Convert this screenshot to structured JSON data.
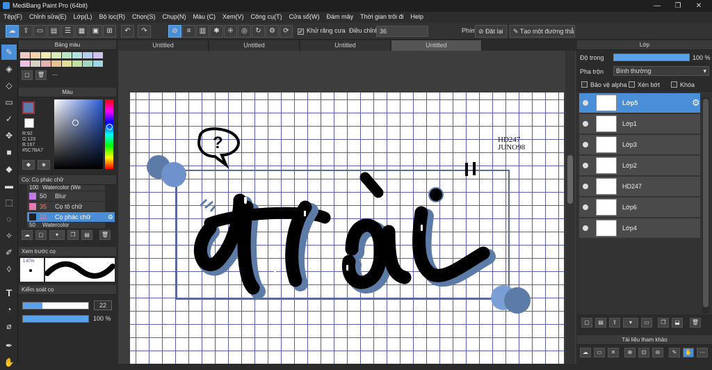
{
  "window": {
    "title": "MediBang Paint Pro (64bit)",
    "minimize": "—",
    "maximize": "❐",
    "close": "✕"
  },
  "menu": [
    "Tệp(F)",
    "Chỉnh sửa(E)",
    "Lớp(L)",
    "Bộ lọc(R)",
    "Chọn(S)",
    "Chụp(N)",
    "Màu (C)",
    "Xem(V)",
    "Công cụ(T)",
    "Cửa sổ(W)",
    "Đám mây",
    "Thời gian trôi đi",
    "Help"
  ],
  "toolbar": {
    "antialias_label": "Khử răng cưa",
    "adjust_label": "Điều chỉnh",
    "adjust_value": "36",
    "stroke_label": "Phím",
    "reset_label": "Đặt lại",
    "create_line_label": "Tạo một đường thẳng"
  },
  "tabs": [
    "Untitled",
    "Untitled",
    "Untitled",
    "Untitled"
  ],
  "palette_panel": {
    "title": "Bảng màu",
    "dash": "---"
  },
  "color_panel": {
    "title": "Màu",
    "r": "R:92",
    "g": "G:123",
    "b": "B:167",
    "hex": "#5C7BA7"
  },
  "brush_panel": {
    "title": "Cọ: Cọ phác chữ",
    "items": [
      {
        "size": "100",
        "name": "Watercolor (We"
      },
      {
        "size": "50",
        "name": "Blur"
      },
      {
        "size": "35",
        "name": "Cọ tô chữ"
      },
      {
        "size": "22",
        "name": "Cọ phác chữ"
      },
      {
        "size": "50",
        "name": "Watercolor"
      }
    ]
  },
  "preview_panel": {
    "title": "Xem trước cọ",
    "size": "1.67m"
  },
  "control_panel": {
    "title": "Kiểm soát cọ",
    "size": "22",
    "opacity": "100 %",
    "size_fraction": 0.3,
    "opacity_fraction": 1.0
  },
  "layer_panel": {
    "title": "Lớp",
    "opacity_label": "Độ trong",
    "opacity_value": "100 %",
    "blend_label": "Pha trộn",
    "blend_value": "Bình thường",
    "protect_alpha": "Bảo vệ alpha",
    "clipping": "Xén bớt",
    "lock": "Khóa",
    "layers": [
      "Lớp5",
      "Lớp1",
      "Lớp3",
      "Lớp2",
      "HD247",
      "Lớp6",
      "Lớp4"
    ]
  },
  "reference_panel": {
    "title": "Tài liệu tham khảo"
  },
  "artwork": {
    "signature_line1": "HD247",
    "signature_line2": "JUNO98",
    "lettering": "Hài",
    "bubble_mark": "?"
  },
  "colors": {
    "accent": "#4a8ed8",
    "art_blue": "#5C7BA7",
    "grid": "#5b5ea6"
  }
}
